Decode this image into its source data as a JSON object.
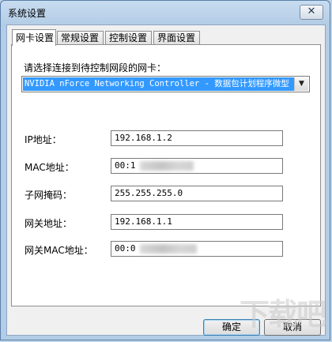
{
  "window": {
    "title": "系统设置",
    "close_glyph": "✕"
  },
  "tabs": [
    {
      "label": "网卡设置",
      "active": true
    },
    {
      "label": "常规设置",
      "active": false
    },
    {
      "label": "控制设置",
      "active": false
    },
    {
      "label": "界面设置",
      "active": false
    }
  ],
  "network": {
    "prompt": "请选择连接到待控制网段的网卡：",
    "adapter_selected": "NVIDIA nForce Networking Controller - 数据包计划程序微型",
    "fields": {
      "ip": {
        "label": "IP地址：",
        "value": "192.168.1.2"
      },
      "mac": {
        "label": "MAC地址：",
        "value": "00:1"
      },
      "subnet": {
        "label": "子网掩码：",
        "value": "255.255.255.0"
      },
      "gateway": {
        "label": "网关地址：",
        "value": "192.168.1.1"
      },
      "gateway_mac": {
        "label": "网关MAC地址：",
        "value": "00:0"
      }
    }
  },
  "buttons": {
    "ok": "确定",
    "cancel": "取消"
  },
  "watermark": "下载吧",
  "colors": {
    "selection": "#3399ff",
    "title_bg": "#b3cde6"
  }
}
